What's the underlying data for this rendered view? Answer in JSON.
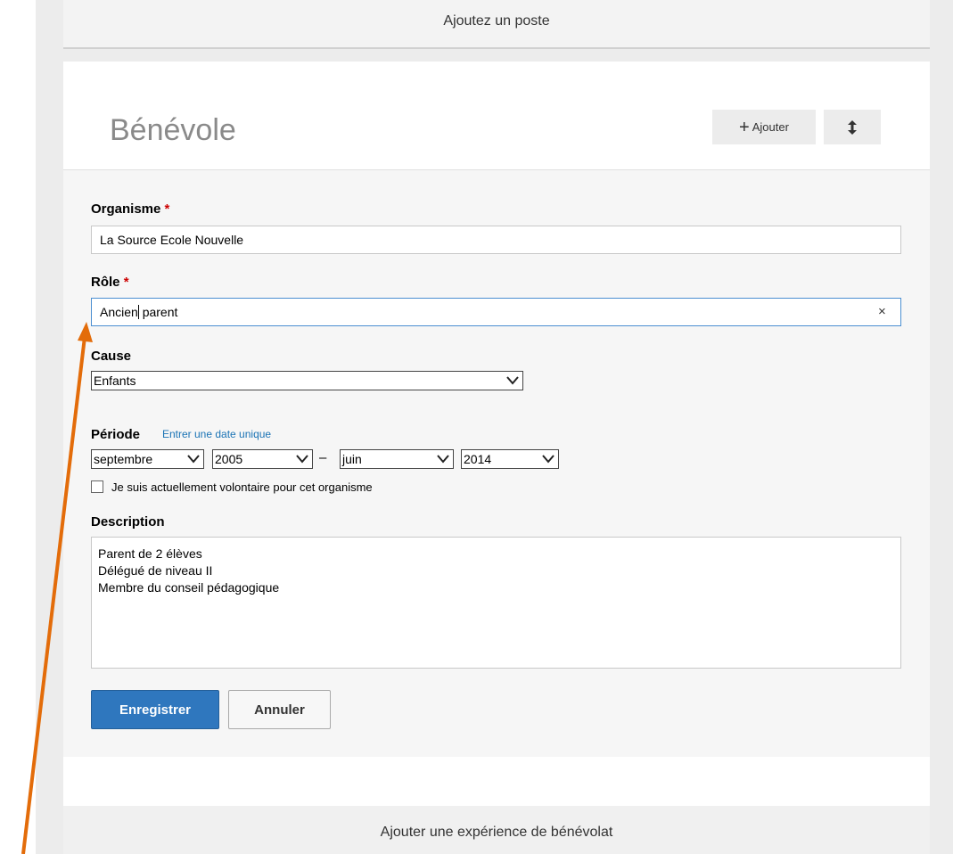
{
  "top_section": {
    "title": "Ajoutez un poste"
  },
  "section": {
    "title": "Bénévole",
    "add_label": "Ajouter"
  },
  "form": {
    "organisme": {
      "label": "Organisme",
      "required_mark": "*",
      "value": "La Source Ecole Nouvelle"
    },
    "role": {
      "label": "Rôle",
      "required_mark": "*",
      "value_before_caret": "Ancien",
      "value_after_caret": " parent",
      "clear_glyph": "×"
    },
    "cause": {
      "label": "Cause",
      "selected": "Enfants"
    },
    "periode": {
      "label": "Période",
      "single_date_link": "Entrer une date unique",
      "start_month": "septembre",
      "start_year": "2005",
      "separator": "–",
      "end_month": "juin",
      "end_year": "2014"
    },
    "current_checkbox": {
      "checked": false,
      "label": "Je suis actuellement volontaire pour cet organisme"
    },
    "description": {
      "label": "Description",
      "lines": [
        "Parent de 2 élèves",
        "Délégué de niveau II",
        "Membre du conseil pédagogique"
      ]
    },
    "save_label": "Enregistrer",
    "cancel_label": "Annuler"
  },
  "bottom_section": {
    "title": "Ajouter une expérience de bénévolat"
  },
  "colors": {
    "accent": "#2f77be",
    "annotation_arrow": "#e36c0a",
    "required": "#cc0000",
    "link": "#1a73b5"
  },
  "icons": {
    "add": "plus-icon",
    "reorder": "vertical-arrows-icon",
    "clear": "close-icon",
    "dropdown": "chevron-down-icon"
  }
}
